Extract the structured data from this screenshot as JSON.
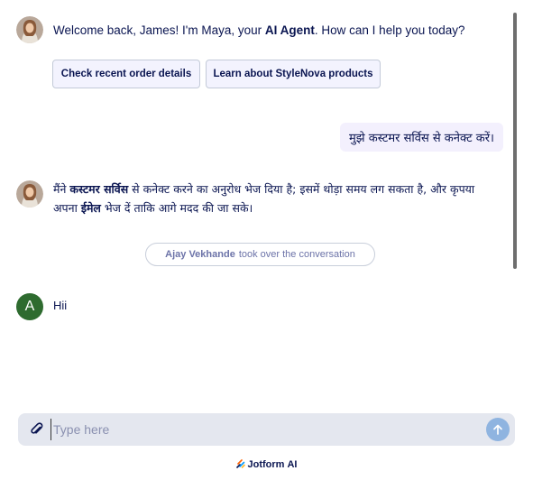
{
  "bot": {
    "avatar_icon": "maya-avatar-icon",
    "welcome_prefix": "Welcome back, James! I'm Maya, your ",
    "welcome_bold": "AI Agent",
    "welcome_suffix": ". How can I help you today?",
    "reply_part1": "मैंने ",
    "reply_bold1": "कस्टमर सर्विस",
    "reply_part2": " से कनेक्ट करने का अनुरोध भेज दिया है; इसमें थोड़ा समय लग सकता है, और कृपया",
    "reply_part3": "अपना ",
    "reply_bold2": "ईमेल",
    "reply_part4": " भेज दें ताकि आगे मदद की जा सके।"
  },
  "suggestions": [
    {
      "label": "Check recent order details"
    },
    {
      "label": "Learn about StyleNova products"
    }
  ],
  "user": {
    "message": "मुझे कस्टमर सर्विस से कनेक्ट करें।"
  },
  "takeover": {
    "agent_name": "Ajay Vekhande",
    "text": "took over the conversation"
  },
  "agent": {
    "initial": "A",
    "message": "Hii",
    "avatar_color": "#2e6b2f"
  },
  "composer": {
    "placeholder": "Type here",
    "attach_icon": "paperclip-icon",
    "send_icon": "arrow-up-icon",
    "send_color": "#8fb4e0"
  },
  "footer": {
    "brand": "Jotform",
    "suffix": "AI"
  }
}
